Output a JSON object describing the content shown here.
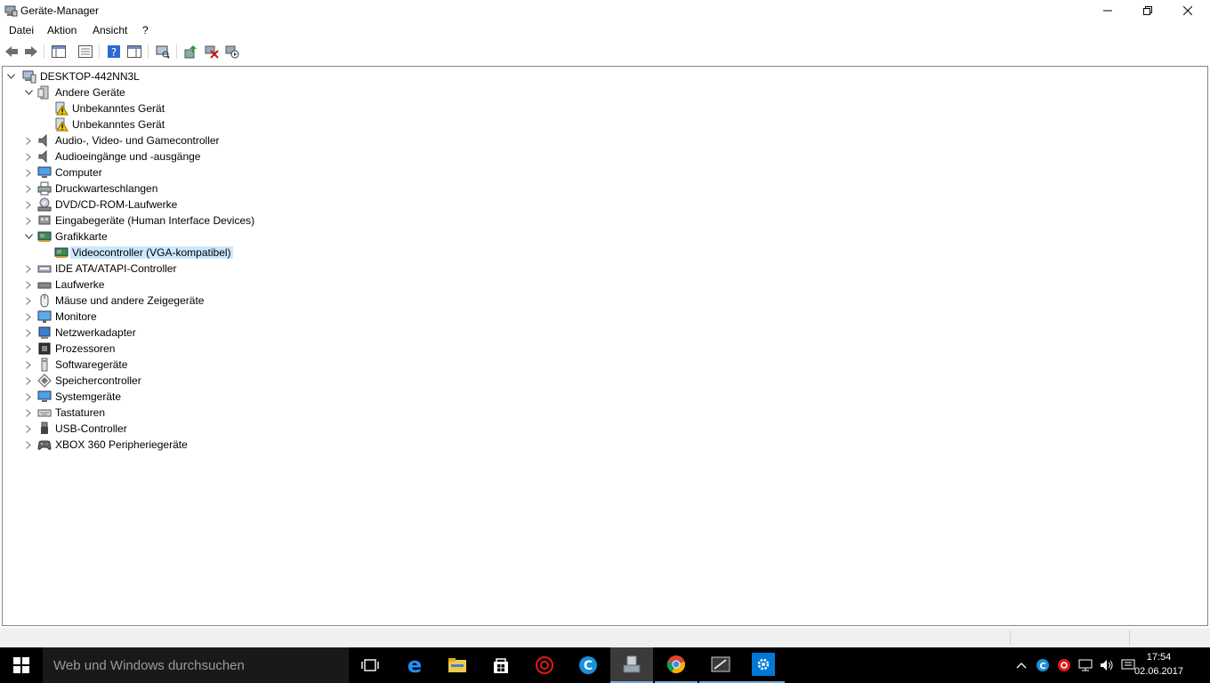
{
  "window": {
    "title": "Geräte-Manager"
  },
  "menu": [
    "Datei",
    "Aktion",
    "Ansicht",
    "?"
  ],
  "tree": {
    "root": "DESKTOP-442NN3L",
    "items": [
      {
        "label": "Andere Geräte",
        "icon": "unknown-device-icon",
        "expanded": true
      },
      {
        "label": "Unbekanntes Gerät",
        "icon": "warning-device-icon",
        "child": true
      },
      {
        "label": "Unbekanntes Gerät",
        "icon": "warning-device-icon",
        "child": true
      },
      {
        "label": "Audio-, Video- und Gamecontroller",
        "icon": "speaker-icon"
      },
      {
        "label": "Audioeingänge und -ausgänge",
        "icon": "speaker-icon"
      },
      {
        "label": "Computer",
        "icon": "computer-icon"
      },
      {
        "label": "Druckwarteschlangen",
        "icon": "printer-icon"
      },
      {
        "label": "DVD/CD-ROM-Laufwerke",
        "icon": "disc-drive-icon"
      },
      {
        "label": "Eingabegeräte (Human Interface Devices)",
        "icon": "hid-icon"
      },
      {
        "label": "Grafikkarte",
        "icon": "display-adapter-icon",
        "expanded": true
      },
      {
        "label": "Videocontroller (VGA-kompatibel)",
        "icon": "display-adapter-icon",
        "child": true,
        "selected": true
      },
      {
        "label": "IDE ATA/ATAPI-Controller",
        "icon": "ide-controller-icon"
      },
      {
        "label": "Laufwerke",
        "icon": "disk-drive-icon"
      },
      {
        "label": "Mäuse und andere Zeigegeräte",
        "icon": "mouse-icon"
      },
      {
        "label": "Monitore",
        "icon": "monitor-icon"
      },
      {
        "label": "Netzwerkadapter",
        "icon": "network-adapter-icon"
      },
      {
        "label": "Prozessoren",
        "icon": "processor-icon"
      },
      {
        "label": "Softwaregeräte",
        "icon": "software-device-icon"
      },
      {
        "label": "Speichercontroller",
        "icon": "storage-controller-icon"
      },
      {
        "label": "Systemgeräte",
        "icon": "system-devices-icon"
      },
      {
        "label": "Tastaturen",
        "icon": "keyboard-icon"
      },
      {
        "label": "USB-Controller",
        "icon": "usb-icon"
      },
      {
        "label": "XBOX 360 Peripheriegeräte",
        "icon": "gamepad-icon"
      }
    ]
  },
  "taskbar": {
    "search_placeholder": "Web und Windows durchsuchen",
    "time": "17:54",
    "date": "02.06.2017"
  },
  "colors": {
    "selection": "#cce8ff",
    "taskbar": "#000000",
    "accent": "#0078d7"
  }
}
